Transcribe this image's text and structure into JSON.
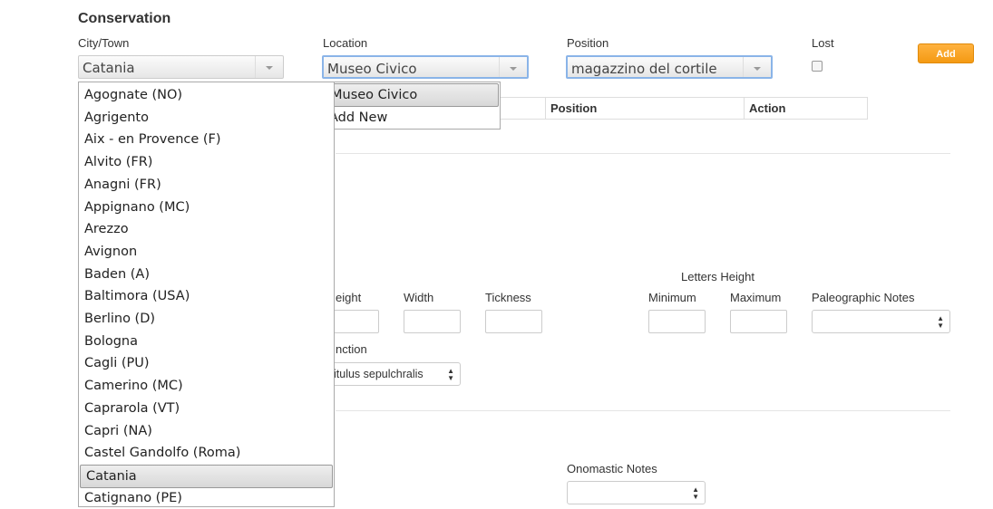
{
  "section": {
    "title": "Conservation"
  },
  "fields": {
    "city_label": "City/Town",
    "city_value": "Catania",
    "location_label": "Location",
    "location_value": "Museo Civico",
    "position_label": "Position",
    "position_value": "magazzino del cortile",
    "lost_label": "Lost"
  },
  "add_button": "Add",
  "table_headers": [
    "Position",
    "Action"
  ],
  "location_options": [
    "Museo Civico",
    "Add New"
  ],
  "city_options": [
    "Agognate (NO)",
    "Agrigento",
    "Aix - en Provence (F)",
    "Alvito (FR)",
    "Anagni (FR)",
    "Appignano (MC)",
    "Arezzo",
    "Avignon",
    "Baden (A)",
    "Baltimora (USA)",
    "Berlino (D)",
    "Bologna",
    "Cagli (PU)",
    "Camerino (MC)",
    "Caprarola (VT)",
    "Capri (NA)",
    "Castel Gandolfo (Roma)",
    "Catania",
    "Catignano (PE)"
  ],
  "city_selected_index": 17,
  "dimensions": {
    "height_label_partial": "eight",
    "width_label": "Width",
    "thickness_label": "Tickness",
    "letters_height_label": "Letters Height",
    "minimum_label": "Minimum",
    "maximum_label": "Maximum",
    "paleographic_label": "Paleographic Notes",
    "function_label_partial": "nction",
    "function_value_partial": "itulus sepulchralis"
  },
  "onomastic_label": "Onomastic Notes"
}
